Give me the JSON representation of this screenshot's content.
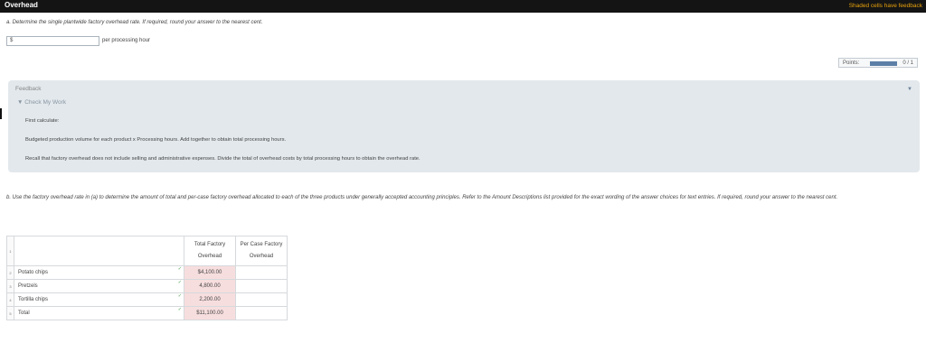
{
  "header": {
    "title": "Overhead",
    "shaded_note": "Shaded cells have feedback"
  },
  "question_a": {
    "prompt": "a. Determine the single plantwide factory overhead rate. If required, round your answer to the nearest cent.",
    "input_value": "$",
    "unit_label": "per processing hour"
  },
  "points": {
    "label": "Points:",
    "value": "0 / 1",
    "progress_fraction": 0
  },
  "feedback": {
    "heading": "Feedback",
    "check_label": "▼ Check My Work",
    "line1": "First calculate:",
    "line2": "Budgeted production volume for each product x Processing hours. Add together to obtain total processing hours.",
    "line3": "Recall that factory overhead does not include selling and administrative expenses. Divide the total of overhead costs by total processing hours to obtain the overhead rate."
  },
  "question_b": {
    "prompt": "b. Use the factory overhead rate in (a) to determine the amount of total and per-case factory overhead allocated to each of the three products under generally accepted accounting principles. Refer to the Amount Descriptions list provided for the exact wording of the answer choices for text entries. If required, round your answer to the nearest cent."
  },
  "table": {
    "row_numbers": [
      "1",
      "2",
      "3",
      "4",
      "5"
    ],
    "headers": {
      "total_line1": "Total Factory",
      "total_line2": "Overhead",
      "percase_line1": "Per Case Factory",
      "percase_line2": "Overhead"
    },
    "rows": [
      {
        "label": "Potato chips",
        "total": "$4,100.00",
        "per_case": ""
      },
      {
        "label": "Pretzels",
        "total": "4,800.00",
        "per_case": ""
      },
      {
        "label": "Tortilla chips",
        "total": "2,200.00",
        "per_case": ""
      },
      {
        "label": "Total",
        "total": "$11,100.00",
        "per_case": ""
      }
    ],
    "check_glyph": "✓"
  },
  "colors": {
    "topbar": "#141414",
    "accent": "#e8a20c",
    "feedback_panel": "#e2e8ec",
    "feedback_cell": "#f7dede",
    "check": "#3a9a3a"
  }
}
